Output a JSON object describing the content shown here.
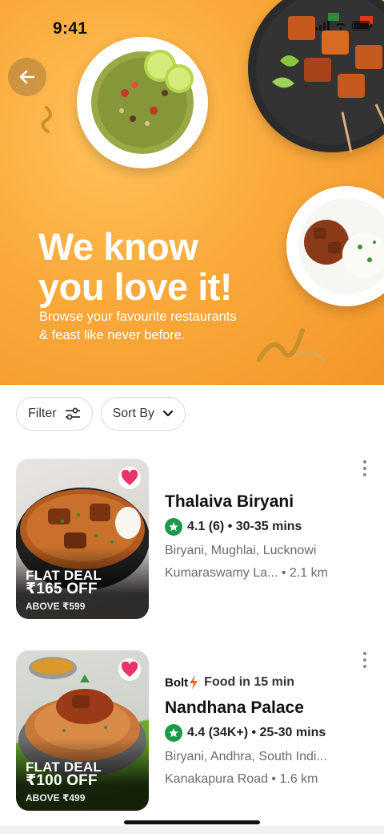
{
  "status_bar": {
    "time": "9:41"
  },
  "hero": {
    "title_line1": "We know",
    "title_line2": "you love it!",
    "subtitle_line1": "Browse your favourite restaurants",
    "subtitle_line2": "& feast like never before."
  },
  "filters": {
    "filter_label": "Filter",
    "sort_label": "Sort By"
  },
  "restaurants": [
    {
      "name": "Thalaiva Biryani",
      "rating": "4.1 (6) • 30-35 mins",
      "cuisines": "Biryani, Mughlai, Lucknowi",
      "location": "Kumaraswamy La... • 2.1 km",
      "deal_line1": "FLAT DEAL",
      "deal_line2": "₹165 OFF",
      "deal_line3": "ABOVE ₹599"
    },
    {
      "badge_brand": "Bolt",
      "badge_text": "Food in 15 min",
      "name": "Nandhana Palace",
      "rating": "4.4 (34K+) • 25-30 mins",
      "cuisines": "Biryani, Andhra, South Indi...",
      "location": "Kanakapura Road • 1.6 km",
      "deal_line1": "FLAT DEAL",
      "deal_line2": "₹100 OFF",
      "deal_line3": "ABOVE ₹499"
    }
  ],
  "colors": {
    "hero_bg": "#f9a93a",
    "rating_green": "#1a9a4a",
    "heart_pink": "#e8336b",
    "bolt_orange": "#f26522"
  },
  "icons": [
    "back-arrow-icon",
    "filter-sliders-icon",
    "chevron-down-icon",
    "heart-icon",
    "star-icon",
    "more-vertical-icon",
    "bolt-icon"
  ]
}
